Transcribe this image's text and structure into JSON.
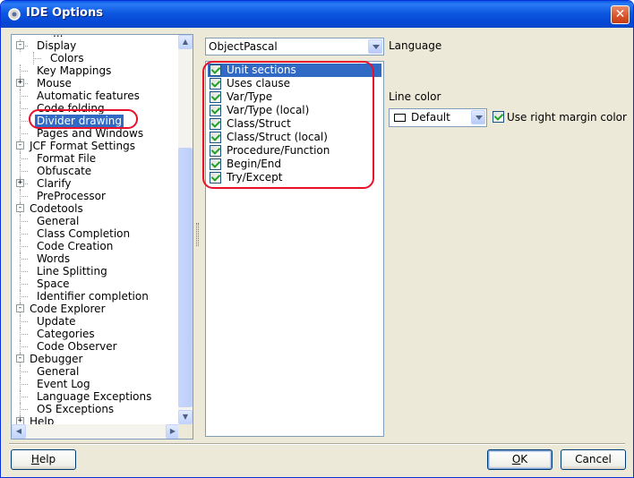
{
  "window": {
    "title": "IDE Options",
    "close_glyph": "✕",
    "icon": "ide-gear-icon"
  },
  "tree": {
    "top_partial": "...",
    "nodes": [
      {
        "label": "Display",
        "level": 1,
        "expander": "-"
      },
      {
        "label": "Colors",
        "level": 2
      },
      {
        "label": "Key Mappings",
        "level": 1
      },
      {
        "label": "Mouse",
        "level": 1,
        "expander": "+"
      },
      {
        "label": "Automatic features",
        "level": 1
      },
      {
        "label": "Code folding",
        "level": 1
      },
      {
        "label": "Divider drawing",
        "level": 1,
        "selected": true
      },
      {
        "label": "Pages and Windows",
        "level": 1
      },
      {
        "label": "JCF Format Settings",
        "level": 0,
        "expander": "-"
      },
      {
        "label": "Format File",
        "level": 1
      },
      {
        "label": "Obfuscate",
        "level": 1
      },
      {
        "label": "Clarify",
        "level": 1,
        "expander": "+"
      },
      {
        "label": "PreProcessor",
        "level": 1
      },
      {
        "label": "Codetools",
        "level": 0,
        "expander": "-"
      },
      {
        "label": "General",
        "level": 1
      },
      {
        "label": "Class Completion",
        "level": 1
      },
      {
        "label": "Code Creation",
        "level": 1
      },
      {
        "label": "Words",
        "level": 1
      },
      {
        "label": "Line Splitting",
        "level": 1
      },
      {
        "label": "Space",
        "level": 1
      },
      {
        "label": "Identifier completion",
        "level": 1
      },
      {
        "label": "Code Explorer",
        "level": 0,
        "expander": "-"
      },
      {
        "label": "Update",
        "level": 1
      },
      {
        "label": "Categories",
        "level": 1
      },
      {
        "label": "Code Observer",
        "level": 1
      },
      {
        "label": "Debugger",
        "level": 0,
        "expander": "-"
      },
      {
        "label": "General",
        "level": 1
      },
      {
        "label": "Event Log",
        "level": 1
      },
      {
        "label": "Language Exceptions",
        "level": 1
      },
      {
        "label": "OS Exceptions",
        "level": 1
      },
      {
        "label": "Help",
        "level": 0,
        "expander": "+"
      }
    ],
    "scroll_up_glyph": "▲",
    "scroll_down_glyph": "▼",
    "scroll_left_glyph": "◀",
    "scroll_right_glyph": "▶"
  },
  "language": {
    "selected": "ObjectPascal",
    "label": "Language"
  },
  "sections": {
    "items": [
      {
        "label": "Unit sections",
        "checked": true,
        "selected": true
      },
      {
        "label": "Uses clause",
        "checked": true
      },
      {
        "label": "Var/Type",
        "checked": true
      },
      {
        "label": "Var/Type (local)",
        "checked": true
      },
      {
        "label": "Class/Struct",
        "checked": true
      },
      {
        "label": "Class/Struct (local)",
        "checked": true
      },
      {
        "label": "Procedure/Function",
        "checked": true
      },
      {
        "label": "Begin/End",
        "checked": true
      },
      {
        "label": "Try/Except",
        "checked": true
      }
    ]
  },
  "line_color": {
    "label": "Line color",
    "value": "Default",
    "use_right_margin_label": "Use right margin color",
    "use_right_margin_checked": true
  },
  "buttons": {
    "help": "Help",
    "ok": "OK",
    "cancel": "Cancel"
  },
  "colors": {
    "title_blue": "#0547d6",
    "selection": "#316ac5",
    "annotation_red": "#e8102a",
    "face": "#ece9d8"
  }
}
